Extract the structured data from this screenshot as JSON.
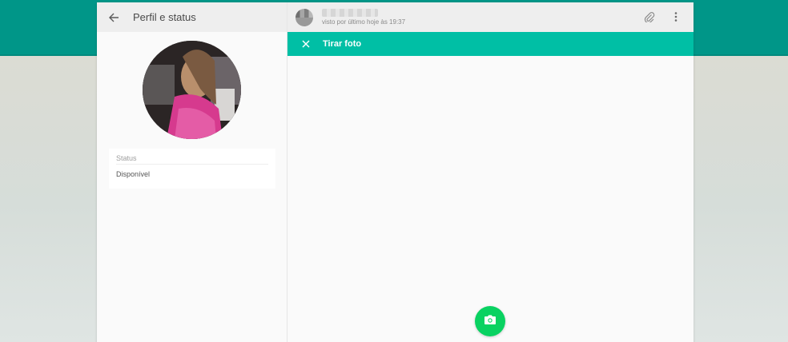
{
  "left_panel": {
    "title": "Perfil e status",
    "back_icon": "arrow-left-icon",
    "status_card": {
      "label": "Status",
      "value": "Disponível"
    }
  },
  "chat_header": {
    "contact_name": "",
    "last_seen": "visto por último hoje às 19:37",
    "actions": [
      "paperclip-icon",
      "more-vert-icon"
    ]
  },
  "photo_bar": {
    "title": "Tirar foto",
    "close_icon": "close-icon"
  },
  "capture_button": {
    "icon": "camera-icon"
  },
  "colors": {
    "top_band": "#009688",
    "photo_bar": "#00bfa5",
    "capture_button": "#09d261",
    "header_bg": "#eeeeee"
  }
}
